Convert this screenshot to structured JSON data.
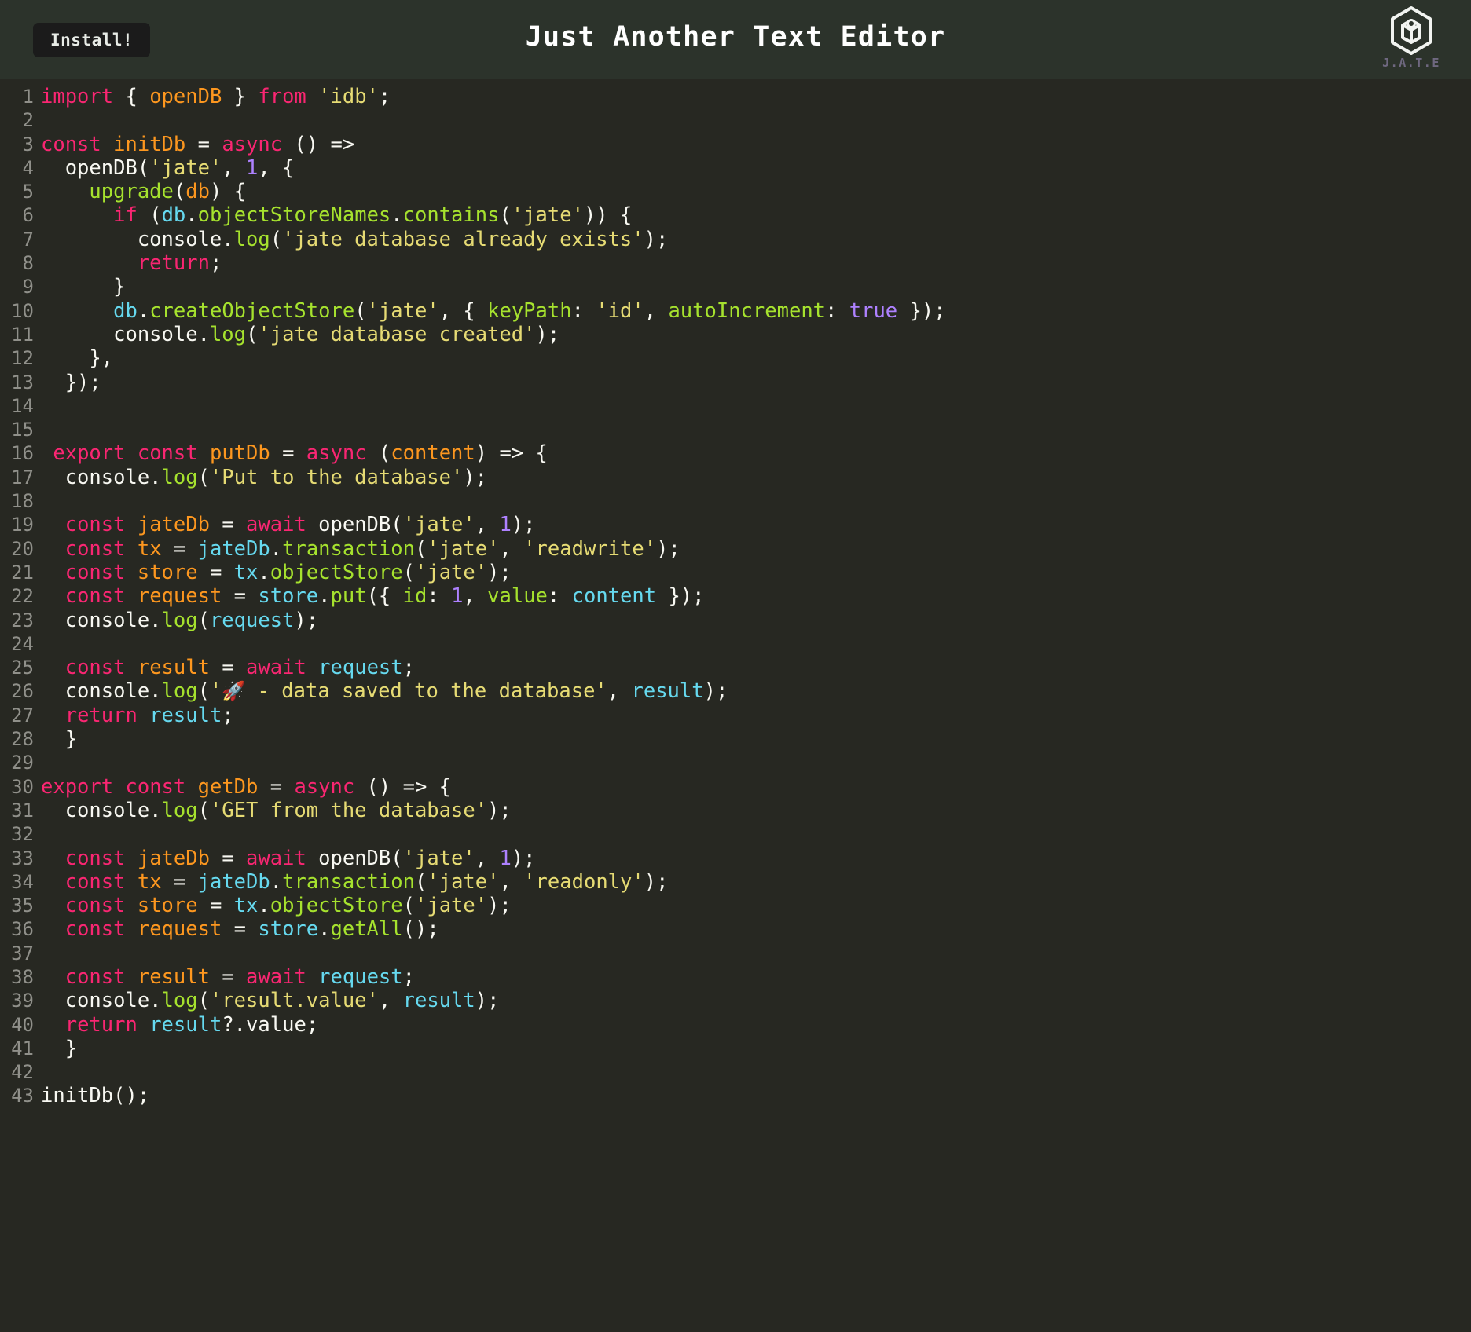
{
  "header": {
    "install_label": "Install!",
    "title": "Just Another Text Editor",
    "logo_word": "J.A.T.E",
    "logo_icon": "jate-hexagon-logo",
    "background_color": "#2c332b",
    "install_button_color": "#1b1b1b",
    "title_color": "#ffffff",
    "logo_word_color": "#6f6880"
  },
  "editor": {
    "background_color": "#272822",
    "gutter_color": "#90908a",
    "total_lines": 43,
    "palette": {
      "punctuation": "#f8f8f2",
      "keyword": "#f92672",
      "declaration": "#fd971f",
      "string": "#e6db74",
      "function": "#a6e22e",
      "number": "#ae81ff",
      "variable": "#66d9ef"
    },
    "lines": [
      {
        "n": "1",
        "tokens": [
          [
            "kw",
            "import"
          ],
          [
            "pun",
            " { "
          ],
          [
            "def",
            "openDB"
          ],
          [
            "pun",
            " } "
          ],
          [
            "kw",
            "from"
          ],
          [
            "pun",
            " "
          ],
          [
            "str",
            "'idb'"
          ],
          [
            "pun",
            ";"
          ]
        ]
      },
      {
        "n": "2",
        "tokens": []
      },
      {
        "n": "3",
        "tokens": [
          [
            "kw",
            "const"
          ],
          [
            "pun",
            " "
          ],
          [
            "def",
            "initDb"
          ],
          [
            "pun",
            " = "
          ],
          [
            "kw",
            "async"
          ],
          [
            "pun",
            " () =>"
          ]
        ]
      },
      {
        "n": "4",
        "tokens": [
          [
            "pun",
            "  openDB("
          ],
          [
            "str",
            "'jate'"
          ],
          [
            "pun",
            ", "
          ],
          [
            "num",
            "1"
          ],
          [
            "pun",
            ", {"
          ]
        ]
      },
      {
        "n": "5",
        "tokens": [
          [
            "pun",
            "    "
          ],
          [
            "fn",
            "upgrade"
          ],
          [
            "pun",
            "("
          ],
          [
            "def",
            "db"
          ],
          [
            "pun",
            ") {"
          ]
        ]
      },
      {
        "n": "6",
        "tokens": [
          [
            "pun",
            "      "
          ],
          [
            "kw",
            "if"
          ],
          [
            "pun",
            " ("
          ],
          [
            "var",
            "db"
          ],
          [
            "pun",
            "."
          ],
          [
            "fn",
            "objectStoreNames"
          ],
          [
            "pun",
            "."
          ],
          [
            "fn",
            "contains"
          ],
          [
            "pun",
            "("
          ],
          [
            "str",
            "'jate'"
          ],
          [
            "pun",
            ")) {"
          ]
        ]
      },
      {
        "n": "7",
        "tokens": [
          [
            "pun",
            "        console."
          ],
          [
            "fn",
            "log"
          ],
          [
            "pun",
            "("
          ],
          [
            "str",
            "'jate database already exists'"
          ],
          [
            "pun",
            ");"
          ]
        ]
      },
      {
        "n": "8",
        "tokens": [
          [
            "pun",
            "        "
          ],
          [
            "kw",
            "return"
          ],
          [
            "pun",
            ";"
          ]
        ]
      },
      {
        "n": "9",
        "tokens": [
          [
            "pun",
            "      }"
          ]
        ]
      },
      {
        "n": "10",
        "tokens": [
          [
            "pun",
            "      "
          ],
          [
            "var",
            "db"
          ],
          [
            "pun",
            "."
          ],
          [
            "fn",
            "createObjectStore"
          ],
          [
            "pun",
            "("
          ],
          [
            "str",
            "'jate'"
          ],
          [
            "pun",
            ", { "
          ],
          [
            "key",
            "keyPath"
          ],
          [
            "pun",
            ": "
          ],
          [
            "str",
            "'id'"
          ],
          [
            "pun",
            ", "
          ],
          [
            "key",
            "autoIncrement"
          ],
          [
            "pun",
            ": "
          ],
          [
            "num",
            "true"
          ],
          [
            "pun",
            " });"
          ]
        ]
      },
      {
        "n": "11",
        "tokens": [
          [
            "pun",
            "      console."
          ],
          [
            "fn",
            "log"
          ],
          [
            "pun",
            "("
          ],
          [
            "str",
            "'jate database created'"
          ],
          [
            "pun",
            ");"
          ]
        ]
      },
      {
        "n": "12",
        "tokens": [
          [
            "pun",
            "    },"
          ]
        ]
      },
      {
        "n": "13",
        "tokens": [
          [
            "pun",
            "  });"
          ]
        ]
      },
      {
        "n": "14",
        "tokens": []
      },
      {
        "n": "15",
        "tokens": []
      },
      {
        "n": "16",
        "tokens": [
          [
            "pun",
            " "
          ],
          [
            "kw",
            "export"
          ],
          [
            "pun",
            " "
          ],
          [
            "kw",
            "const"
          ],
          [
            "pun",
            " "
          ],
          [
            "def",
            "putDb"
          ],
          [
            "pun",
            " = "
          ],
          [
            "kw",
            "async"
          ],
          [
            "pun",
            " ("
          ],
          [
            "def",
            "content"
          ],
          [
            "pun",
            ") => {"
          ]
        ]
      },
      {
        "n": "17",
        "tokens": [
          [
            "pun",
            "  console."
          ],
          [
            "fn",
            "log"
          ],
          [
            "pun",
            "("
          ],
          [
            "str",
            "'Put to the database'"
          ],
          [
            "pun",
            ");"
          ]
        ]
      },
      {
        "n": "18",
        "tokens": []
      },
      {
        "n": "19",
        "tokens": [
          [
            "pun",
            "  "
          ],
          [
            "kw",
            "const"
          ],
          [
            "pun",
            " "
          ],
          [
            "def",
            "jateDb"
          ],
          [
            "pun",
            " = "
          ],
          [
            "kw",
            "await"
          ],
          [
            "pun",
            " openDB("
          ],
          [
            "str",
            "'jate'"
          ],
          [
            "pun",
            ", "
          ],
          [
            "num",
            "1"
          ],
          [
            "pun",
            ");"
          ]
        ]
      },
      {
        "n": "20",
        "tokens": [
          [
            "pun",
            "  "
          ],
          [
            "kw",
            "const"
          ],
          [
            "pun",
            " "
          ],
          [
            "def",
            "tx"
          ],
          [
            "pun",
            " = "
          ],
          [
            "var",
            "jateDb"
          ],
          [
            "pun",
            "."
          ],
          [
            "fn",
            "transaction"
          ],
          [
            "pun",
            "("
          ],
          [
            "str",
            "'jate'"
          ],
          [
            "pun",
            ", "
          ],
          [
            "str",
            "'readwrite'"
          ],
          [
            "pun",
            ");"
          ]
        ]
      },
      {
        "n": "21",
        "tokens": [
          [
            "pun",
            "  "
          ],
          [
            "kw",
            "const"
          ],
          [
            "pun",
            " "
          ],
          [
            "def",
            "store"
          ],
          [
            "pun",
            " = "
          ],
          [
            "var",
            "tx"
          ],
          [
            "pun",
            "."
          ],
          [
            "fn",
            "objectStore"
          ],
          [
            "pun",
            "("
          ],
          [
            "str",
            "'jate'"
          ],
          [
            "pun",
            ");"
          ]
        ]
      },
      {
        "n": "22",
        "tokens": [
          [
            "pun",
            "  "
          ],
          [
            "kw",
            "const"
          ],
          [
            "pun",
            " "
          ],
          [
            "def",
            "request"
          ],
          [
            "pun",
            " = "
          ],
          [
            "var",
            "store"
          ],
          [
            "pun",
            "."
          ],
          [
            "fn",
            "put"
          ],
          [
            "pun",
            "({ "
          ],
          [
            "key",
            "id"
          ],
          [
            "pun",
            ": "
          ],
          [
            "num",
            "1"
          ],
          [
            "pun",
            ", "
          ],
          [
            "key",
            "value"
          ],
          [
            "pun",
            ": "
          ],
          [
            "var",
            "content"
          ],
          [
            "pun",
            " });"
          ]
        ]
      },
      {
        "n": "23",
        "tokens": [
          [
            "pun",
            "  console."
          ],
          [
            "fn",
            "log"
          ],
          [
            "pun",
            "("
          ],
          [
            "var",
            "request"
          ],
          [
            "pun",
            ");"
          ]
        ]
      },
      {
        "n": "24",
        "tokens": []
      },
      {
        "n": "25",
        "tokens": [
          [
            "pun",
            "  "
          ],
          [
            "kw",
            "const"
          ],
          [
            "pun",
            " "
          ],
          [
            "def",
            "result"
          ],
          [
            "pun",
            " = "
          ],
          [
            "kw",
            "await"
          ],
          [
            "pun",
            " "
          ],
          [
            "var",
            "request"
          ],
          [
            "pun",
            ";"
          ]
        ]
      },
      {
        "n": "26",
        "tokens": [
          [
            "pun",
            "  console."
          ],
          [
            "fn",
            "log"
          ],
          [
            "pun",
            "("
          ],
          [
            "str",
            "'"
          ],
          [
            "emoji",
            "🚀"
          ],
          [
            "str",
            " - data saved to the database'"
          ],
          [
            "pun",
            ", "
          ],
          [
            "var",
            "result"
          ],
          [
            "pun",
            ");"
          ]
        ]
      },
      {
        "n": "27",
        "tokens": [
          [
            "pun",
            "  "
          ],
          [
            "kw",
            "return"
          ],
          [
            "pun",
            " "
          ],
          [
            "var",
            "result"
          ],
          [
            "pun",
            ";"
          ]
        ]
      },
      {
        "n": "28",
        "tokens": [
          [
            "pun",
            "  }"
          ]
        ]
      },
      {
        "n": "29",
        "tokens": []
      },
      {
        "n": "30",
        "tokens": [
          [
            "kw",
            "export"
          ],
          [
            "pun",
            " "
          ],
          [
            "kw",
            "const"
          ],
          [
            "pun",
            " "
          ],
          [
            "def",
            "getDb"
          ],
          [
            "pun",
            " = "
          ],
          [
            "kw",
            "async"
          ],
          [
            "pun",
            " () => {"
          ]
        ]
      },
      {
        "n": "31",
        "tokens": [
          [
            "pun",
            "  console."
          ],
          [
            "fn",
            "log"
          ],
          [
            "pun",
            "("
          ],
          [
            "str",
            "'GET from the database'"
          ],
          [
            "pun",
            ");"
          ]
        ]
      },
      {
        "n": "32",
        "tokens": []
      },
      {
        "n": "33",
        "tokens": [
          [
            "pun",
            "  "
          ],
          [
            "kw",
            "const"
          ],
          [
            "pun",
            " "
          ],
          [
            "def",
            "jateDb"
          ],
          [
            "pun",
            " = "
          ],
          [
            "kw",
            "await"
          ],
          [
            "pun",
            " openDB("
          ],
          [
            "str",
            "'jate'"
          ],
          [
            "pun",
            ", "
          ],
          [
            "num",
            "1"
          ],
          [
            "pun",
            ");"
          ]
        ]
      },
      {
        "n": "34",
        "tokens": [
          [
            "pun",
            "  "
          ],
          [
            "kw",
            "const"
          ],
          [
            "pun",
            " "
          ],
          [
            "def",
            "tx"
          ],
          [
            "pun",
            " = "
          ],
          [
            "var",
            "jateDb"
          ],
          [
            "pun",
            "."
          ],
          [
            "fn",
            "transaction"
          ],
          [
            "pun",
            "("
          ],
          [
            "str",
            "'jate'"
          ],
          [
            "pun",
            ", "
          ],
          [
            "str",
            "'readonly'"
          ],
          [
            "pun",
            ");"
          ]
        ]
      },
      {
        "n": "35",
        "tokens": [
          [
            "pun",
            "  "
          ],
          [
            "kw",
            "const"
          ],
          [
            "pun",
            " "
          ],
          [
            "def",
            "store"
          ],
          [
            "pun",
            " = "
          ],
          [
            "var",
            "tx"
          ],
          [
            "pun",
            "."
          ],
          [
            "fn",
            "objectStore"
          ],
          [
            "pun",
            "("
          ],
          [
            "str",
            "'jate'"
          ],
          [
            "pun",
            ");"
          ]
        ]
      },
      {
        "n": "36",
        "tokens": [
          [
            "pun",
            "  "
          ],
          [
            "kw",
            "const"
          ],
          [
            "pun",
            " "
          ],
          [
            "def",
            "request"
          ],
          [
            "pun",
            " = "
          ],
          [
            "var",
            "store"
          ],
          [
            "pun",
            "."
          ],
          [
            "fn",
            "getAll"
          ],
          [
            "pun",
            "();"
          ]
        ]
      },
      {
        "n": "37",
        "tokens": []
      },
      {
        "n": "38",
        "tokens": [
          [
            "pun",
            "  "
          ],
          [
            "kw",
            "const"
          ],
          [
            "pun",
            " "
          ],
          [
            "def",
            "result"
          ],
          [
            "pun",
            " = "
          ],
          [
            "kw",
            "await"
          ],
          [
            "pun",
            " "
          ],
          [
            "var",
            "request"
          ],
          [
            "pun",
            ";"
          ]
        ]
      },
      {
        "n": "39",
        "tokens": [
          [
            "pun",
            "  console."
          ],
          [
            "fn",
            "log"
          ],
          [
            "pun",
            "("
          ],
          [
            "str",
            "'result.value'"
          ],
          [
            "pun",
            ", "
          ],
          [
            "var",
            "result"
          ],
          [
            "pun",
            ");"
          ]
        ]
      },
      {
        "n": "40",
        "tokens": [
          [
            "pun",
            "  "
          ],
          [
            "kw",
            "return"
          ],
          [
            "pun",
            " "
          ],
          [
            "var",
            "result"
          ],
          [
            "pun",
            "?.value;"
          ]
        ]
      },
      {
        "n": "41",
        "tokens": [
          [
            "pun",
            "  }"
          ]
        ]
      },
      {
        "n": "42",
        "tokens": []
      },
      {
        "n": "43",
        "tokens": [
          [
            "pun",
            "initDb();"
          ]
        ]
      }
    ]
  }
}
